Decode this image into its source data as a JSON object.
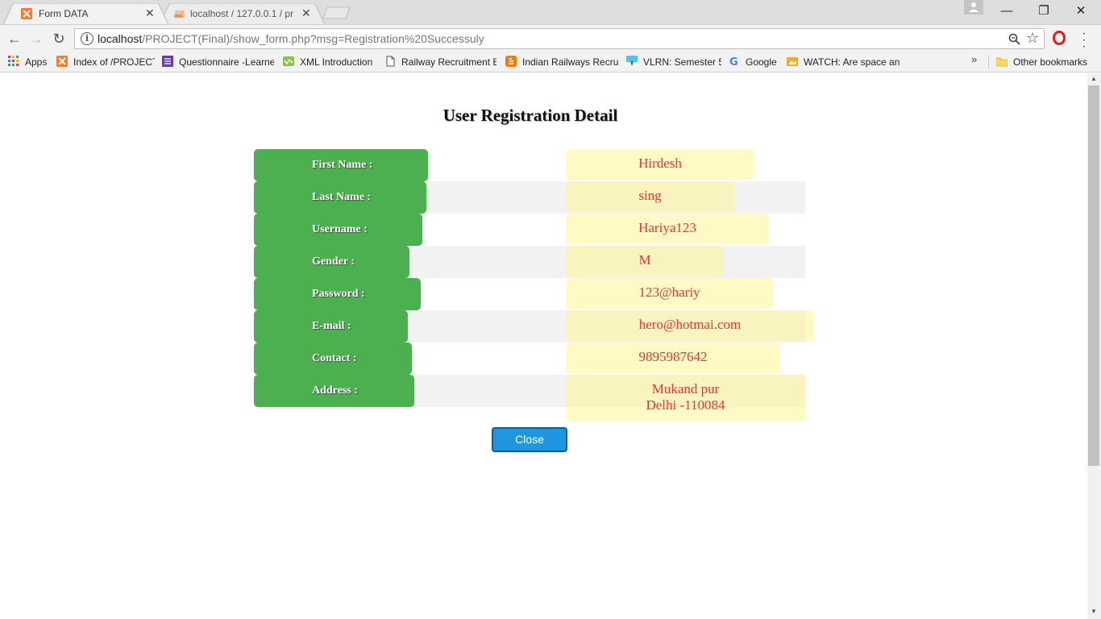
{
  "browser": {
    "tabs": [
      {
        "title": "Form DATA",
        "active": true,
        "favicon": "xampp-icon"
      },
      {
        "title": "localhost / 127.0.0.1 / pr",
        "active": false,
        "favicon": "phpmyadmin-icon"
      }
    ],
    "window_controls": {
      "minimize": "—",
      "restore": "❐",
      "close": "✕"
    },
    "url_host": "localhost",
    "url_path": "/PROJECT(Final)/show_form.php?msg=Registration%20Successuly",
    "bookmarks": [
      {
        "label": "Apps",
        "icon": "apps-grid-icon"
      },
      {
        "label": "Index of /PROJECT",
        "icon": "xampp-icon"
      },
      {
        "label": "Questionnaire -Learne",
        "icon": "list-icon"
      },
      {
        "label": "XML Introduction",
        "icon": "w3-icon"
      },
      {
        "label": "Railway Recruitment E",
        "icon": "page-icon"
      },
      {
        "label": "Indian Railways Recru",
        "icon": "blogger-icon"
      },
      {
        "label": "VLRN: Semester 5",
        "icon": "vlrn-icon"
      },
      {
        "label": "Google",
        "icon": "google-icon"
      },
      {
        "label": "WATCH: Are space and",
        "icon": "folder-image-icon"
      }
    ],
    "more_bookmarks": "»",
    "other_bookmarks": "Other bookmarks"
  },
  "page": {
    "title": "User Registration Detail",
    "fields": [
      {
        "label": "First Name :",
        "value": "Hirdesh"
      },
      {
        "label": "Last Name :",
        "value": "sing"
      },
      {
        "label": "Username :",
        "value": "Hariya123"
      },
      {
        "label": "Gender :",
        "value": "M"
      },
      {
        "label": "Password :",
        "value": "123@hariy"
      },
      {
        "label": "E-mail :",
        "value": "hero@hotmai.com"
      },
      {
        "label": "Contact :",
        "value": "9895987642"
      },
      {
        "label": "Address :",
        "value_line1": "Mukand pur",
        "value_line2": "Delhi -110084"
      }
    ],
    "close_button": "Close"
  },
  "colors": {
    "label_bg": "#4caf50",
    "value_bg": "#fff5a8",
    "value_text": "#e53935",
    "button_bg": "#2196e0"
  }
}
